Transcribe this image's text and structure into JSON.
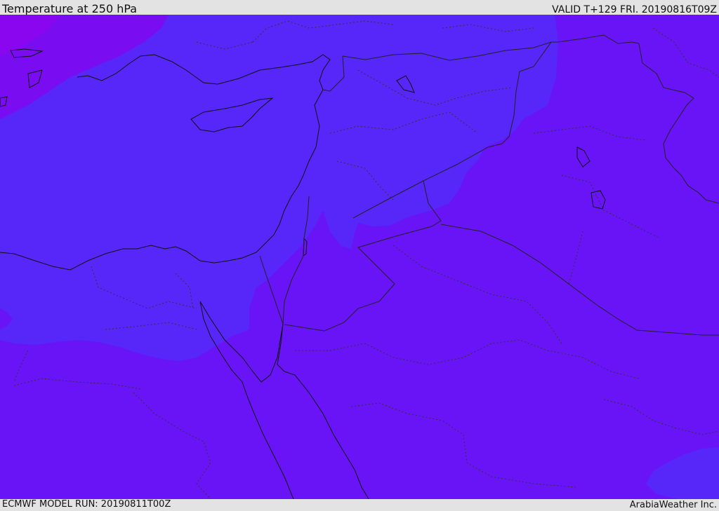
{
  "header": {
    "title": "Temperature at 250 hPa",
    "valid_time": "VALID T+129 FRI. 20190816T09Z"
  },
  "footer": {
    "model_run": "ECMWF MODEL RUN: 20190811T00Z",
    "credit": "ArabiaWeather Inc."
  },
  "map": {
    "field": "Temperature",
    "level": "250 hPa",
    "colors": {
      "warm_band": "#6814f7",
      "mid_band": "#5726f9",
      "cold_band": "#7a0cf2",
      "coast_line": "#111111",
      "border_line": "#222222"
    }
  }
}
